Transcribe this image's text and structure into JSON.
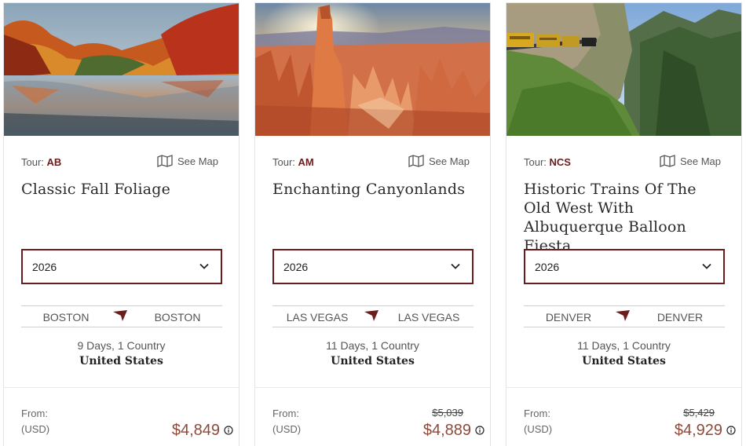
{
  "tours": [
    {
      "tour_label": "Tour:",
      "tour_code": "AB",
      "see_map": "See Map",
      "title": "Classic Fall Foliage",
      "year": "2026",
      "route_from": "BOSTON",
      "route_to": "BOSTON",
      "duration": "9 Days, 1 Country",
      "country": "United States",
      "from_label": "From:",
      "currency": "(USD)",
      "old_price": "",
      "price": "$4,849",
      "image": "autumn-river-photo"
    },
    {
      "tour_label": "Tour:",
      "tour_code": "AM",
      "see_map": "See Map",
      "title": "Enchanting Canyonlands",
      "year": "2026",
      "route_from": "LAS VEGAS",
      "route_to": "LAS VEGAS",
      "duration": "11 Days, 1 Country",
      "country": "United States",
      "from_label": "From:",
      "currency": "(USD)",
      "old_price": "$5,039",
      "price": "$4,889",
      "image": "canyon-hoodoos-photo"
    },
    {
      "tour_label": "Tour:",
      "tour_code": "NCS",
      "see_map": "See Map",
      "title": "Historic Trains Of The Old West With Albuquerque Balloon Fiesta",
      "year": "2026",
      "route_from": "DENVER",
      "route_to": "DENVER",
      "duration": "11 Days, 1 Country",
      "country": "United States",
      "from_label": "From:",
      "currency": "(USD)",
      "old_price": "$5,429",
      "price": "$4,929",
      "image": "mountain-train-photo"
    }
  ],
  "colors": {
    "accent": "#6b1d1d",
    "price": "#8c4a3b",
    "border": "#e3e3e3"
  },
  "icons": {
    "map": "map-icon",
    "chevron": "chevron-down-icon",
    "route": "route-arrow-icon",
    "info": "info-icon"
  }
}
